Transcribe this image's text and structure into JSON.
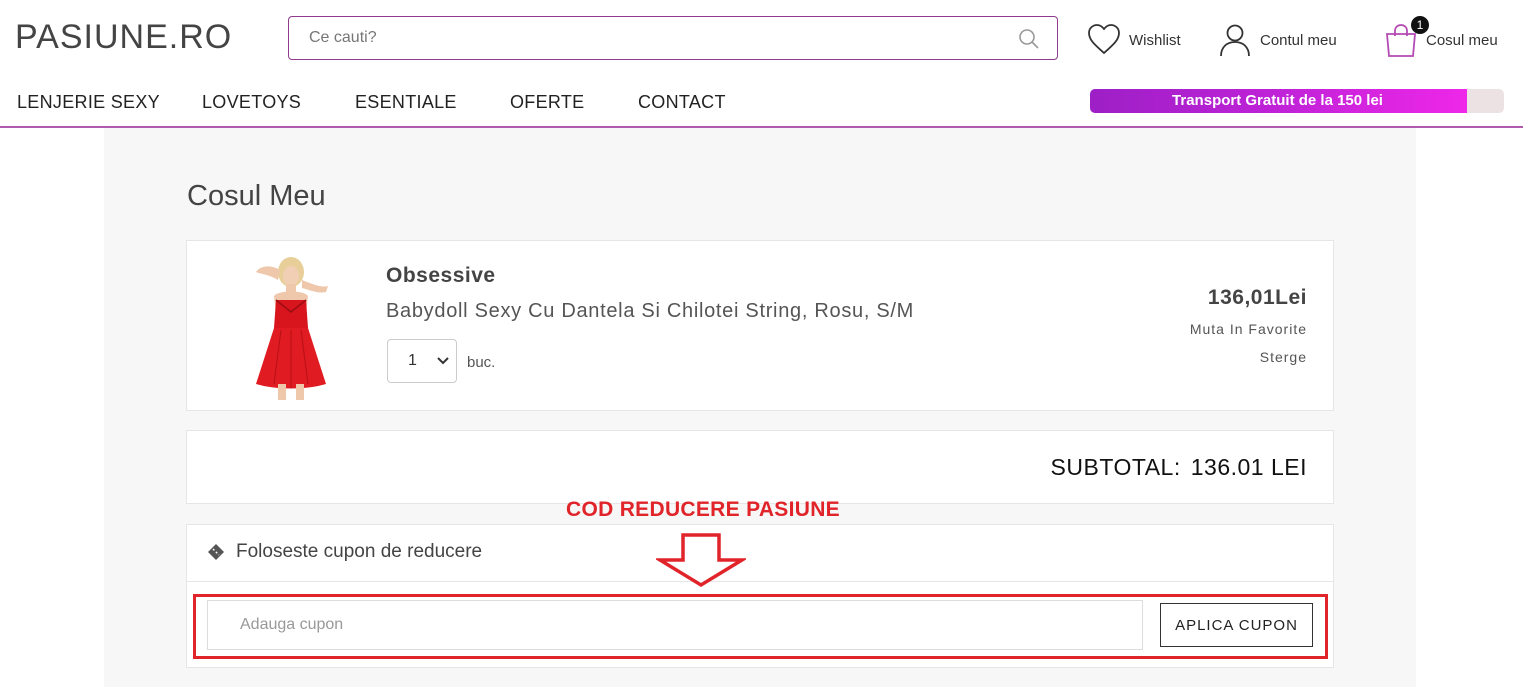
{
  "header": {
    "logo": "PASIUNE.RO",
    "search_placeholder": "Ce cauti?",
    "wishlist_label": "Wishlist",
    "account_label": "Contul meu",
    "cart_label": "Cosul meu",
    "cart_count": "1"
  },
  "nav": {
    "items": [
      "LENJERIE SEXY",
      "LOVETOYS",
      "ESENTIALE",
      "OFERTE",
      "CONTACT"
    ],
    "shipping_text": "Transport Gratuit de la 150 lei",
    "shipping_progress_percent": 91
  },
  "cart": {
    "title": "Cosul Meu",
    "item": {
      "brand": "Obsessive",
      "name": "Babydoll Sexy Cu Dantela Si Chilotei String, Rosu, S/M",
      "quantity": "1",
      "unit": "buc.",
      "price": "136,01Lei",
      "move_to_favorites": "Muta In Favorite",
      "remove": "Sterge"
    },
    "subtotal_label": "SUBTOTAL:",
    "subtotal_value": "136.01 LEI"
  },
  "annotation": "COD REDUCERE PASIUNE",
  "coupon": {
    "heading": "Foloseste cupon de reducere",
    "placeholder": "Adauga cupon",
    "apply_label": "APLICA CUPON"
  },
  "colors": {
    "accent": "#8e3b8e",
    "annotation_red": "#e0242a",
    "shipping_bar_start": "#9d1fc6",
    "shipping_bar_end": "#ef27e8"
  }
}
